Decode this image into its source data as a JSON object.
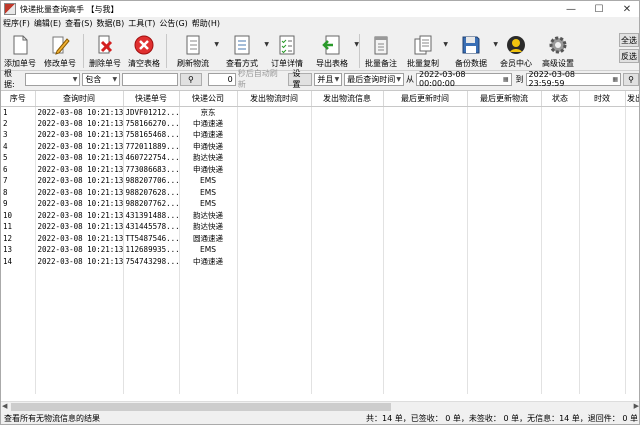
{
  "window": {
    "title": "快递批量查询高手 【与我】"
  },
  "menu": [
    "程序(F)",
    "编辑(E)",
    "查看(S)",
    "数据(B)",
    "工具(T)",
    "公告(G)",
    "帮助(H)"
  ],
  "toolbar": {
    "add": "添加单号",
    "edit": "修改单号",
    "delete": "删除单号",
    "clear": "清空表格",
    "refresh": "刷新物流",
    "view": "查看方式",
    "order": "订单详情",
    "export": "导出表格",
    "remark": "批量备注",
    "copy": "批量复制",
    "backup": "备份数据",
    "member": "会员中心",
    "settings": "高级设置",
    "select_all": "全选",
    "invert": "反选"
  },
  "filter": {
    "label": "根据:",
    "field": "",
    "match": "包含",
    "keyword": "",
    "interval": "0",
    "auto_label": "秒后自动刷新",
    "settings": "设置",
    "logic": "并且",
    "time_field": "最后查询时间",
    "from": "从",
    "start": "2022-03-08 00:00:00",
    "to": "到",
    "end": "2022-03-08 23:59:59"
  },
  "table": {
    "columns": [
      "序号",
      "查询时间",
      "快递单号",
      "快递公司",
      "发出物流时间",
      "发出物流信息",
      "最后更新时间",
      "最后更新物流",
      "状态",
      "时效",
      "发出日期"
    ],
    "rows": [
      [
        "1",
        "2022-03-08  10:21:13",
        "JDVF01212...",
        "京东"
      ],
      [
        "2",
        "2022-03-08  10:21:13",
        "758166270...",
        "中通速递"
      ],
      [
        "3",
        "2022-03-08  10:21:13",
        "758165468...",
        "中通速递"
      ],
      [
        "4",
        "2022-03-08  10:21:13",
        "772011889...",
        "申通快递"
      ],
      [
        "5",
        "2022-03-08  10:21:13",
        "460722754...",
        "韵达快递"
      ],
      [
        "6",
        "2022-03-08  10:21:13",
        "773086683...",
        "申通快递"
      ],
      [
        "7",
        "2022-03-08  10:21:13",
        "988207706...",
        "EMS"
      ],
      [
        "8",
        "2022-03-08  10:21:13",
        "988207628...",
        "EMS"
      ],
      [
        "9",
        "2022-03-08  10:21:13",
        "988207762...",
        "EMS"
      ],
      [
        "10",
        "2022-03-08  10:21:13",
        "431391488...",
        "韵达快递"
      ],
      [
        "11",
        "2022-03-08  10:21:13",
        "431445578...",
        "韵达快递"
      ],
      [
        "12",
        "2022-03-08  10:21:13",
        "TT5487546...",
        "圆通速递"
      ],
      [
        "13",
        "2022-03-08  10:21:13",
        "112689935...",
        "EMS"
      ],
      [
        "14",
        "2022-03-08  10:21:13",
        "754743298...",
        "中通速递"
      ]
    ]
  },
  "status": {
    "left": "查看所有无物流信息的结果",
    "right": "共：14 单，已签收： 0 单，未签收： 0 单，无信息：14 单，退回件： 0 单"
  },
  "colors": {
    "accent": "#c0392b",
    "window_bg": "#f0f0f0",
    "grid_bg": "#ffffff"
  }
}
